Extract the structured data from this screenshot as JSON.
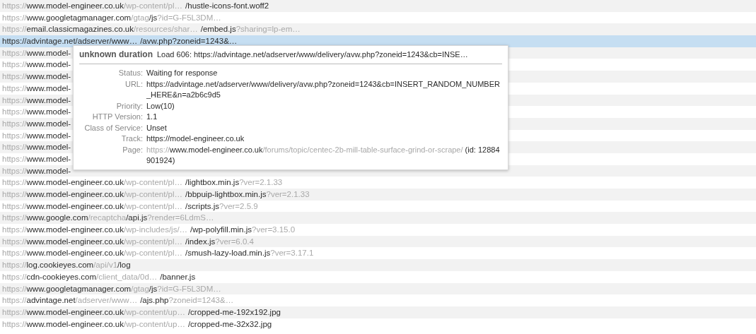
{
  "requests": [
    {
      "scheme": "https://",
      "host": "www.model-engineer.co.uk",
      "path": "/wp-content/pl…",
      "file": "/hustle-icons-font.woff2",
      "selected": false
    },
    {
      "scheme": "https://",
      "host": "www.googletagmanager.com",
      "path": "/gtag",
      "file": "/js",
      "query": "?id=G-F5L3DM…",
      "selected": false
    },
    {
      "scheme": "https://",
      "host": "email.classicmagazines.co.uk",
      "path": "/resources/shar…",
      "file": "/embed.js",
      "query": "?sharing=lp-em…",
      "selected": false
    },
    {
      "scheme": "https://",
      "host": "advintage.net",
      "path": "/adserver/www…",
      "file": "/avw.php",
      "query": "?zoneid=1243&…",
      "selected": true
    },
    {
      "scheme": "https://",
      "host": "www.model-",
      "selected": false
    },
    {
      "scheme": "https://",
      "host": "www.model-",
      "selected": false
    },
    {
      "scheme": "https://",
      "host": "www.model-",
      "selected": false
    },
    {
      "scheme": "https://",
      "host": "www.model-",
      "selected": false
    },
    {
      "scheme": "https://",
      "host": "www.model-",
      "selected": false
    },
    {
      "scheme": "https://",
      "host": "www.model-",
      "selected": false
    },
    {
      "scheme": "https://",
      "host": "www.model-",
      "selected": false
    },
    {
      "scheme": "https://",
      "host": "www.model-",
      "selected": false
    },
    {
      "scheme": "https://",
      "host": "www.model-",
      "selected": false
    },
    {
      "scheme": "https://",
      "host": "www.model-",
      "selected": false
    },
    {
      "scheme": "https://",
      "host": "www.model-",
      "selected": false
    },
    {
      "scheme": "https://",
      "host": "www.model-engineer.co.uk",
      "path": "/wp-content/pl…",
      "file": "/lightbox.min.js",
      "query": "?ver=2.1.33",
      "selected": false
    },
    {
      "scheme": "https://",
      "host": "www.model-engineer.co.uk",
      "path": "/wp-content/pl…",
      "file": "/bbpuip-lightbox.min.js",
      "query": "?ver=2.1.33",
      "selected": false
    },
    {
      "scheme": "https://",
      "host": "www.model-engineer.co.uk",
      "path": "/wp-content/pl…",
      "file": "/scripts.js",
      "query": "?ver=2.5.9",
      "selected": false
    },
    {
      "scheme": "https://",
      "host": "www.google.com",
      "path": "/recaptcha",
      "file": "/api.js",
      "query": "?render=6LdmS…",
      "selected": false
    },
    {
      "scheme": "https://",
      "host": "www.model-engineer.co.uk",
      "path": "/wp-includes/js/…",
      "file": "/wp-polyfill.min.js",
      "query": "?ver=3.15.0",
      "selected": false
    },
    {
      "scheme": "https://",
      "host": "www.model-engineer.co.uk",
      "path": "/wp-content/pl…",
      "file": "/index.js",
      "query": "?ver=6.0.4",
      "selected": false
    },
    {
      "scheme": "https://",
      "host": "www.model-engineer.co.uk",
      "path": "/wp-content/pl…",
      "file": "/smush-lazy-load.min.js",
      "query": "?ver=3.17.1",
      "selected": false
    },
    {
      "scheme": "https://",
      "host": "log.cookieyes.com",
      "path": "/api/v1",
      "file": "/log",
      "selected": false
    },
    {
      "scheme": "https://",
      "host": "cdn-cookieyes.com",
      "path": "/client_data/0d…",
      "file": "/banner.js",
      "selected": false
    },
    {
      "scheme": "https://",
      "host": "www.googletagmanager.com",
      "path": "/gtag",
      "file": "/js",
      "query": "?id=G-F5L3DM…",
      "selected": false
    },
    {
      "scheme": "https://",
      "host": "advintage.net",
      "path": "/adserver/www…",
      "file": "/ajs.php",
      "query": "?zoneid=1243&…",
      "selected": false
    },
    {
      "scheme": "https://",
      "host": "www.model-engineer.co.uk",
      "path": "/wp-content/up…",
      "file": "/cropped-me-192x192.jpg",
      "selected": false
    },
    {
      "scheme": "https://",
      "host": "www.model-engineer.co.uk",
      "path": "/wp-content/up…",
      "file": "/cropped-me-32x32.jpg",
      "selected": false
    }
  ],
  "tooltip": {
    "duration": "unknown duration",
    "heading": "Load 606: https://advintage.net/adserver/www/delivery/avw.php?zoneid=1243&cb=INSE…",
    "fields": [
      {
        "label": "Status:",
        "value": "Waiting for response"
      },
      {
        "label": "URL:",
        "value": "https://advintage.net/adserver/www/delivery/avw.php?zoneid=1243&cb=INSERT_RANDOM_NUMBER_HERE&n=a2b6c9d5"
      },
      {
        "label": "Priority:",
        "value": "Low(10)"
      },
      {
        "label": "HTTP Version:",
        "value": "1.1"
      },
      {
        "label": "Class of Service:",
        "value": "Unset"
      },
      {
        "label": "Track:",
        "value": "https://model-engineer.co.uk"
      },
      {
        "label": "Page:",
        "scheme": "https://",
        "host": "www.model-engineer.co.uk",
        "path": "/forums/topic/centec-2b-mill-table-surface-grind-or-scrape/",
        "suffix": " (id: 12884901924)"
      }
    ]
  }
}
